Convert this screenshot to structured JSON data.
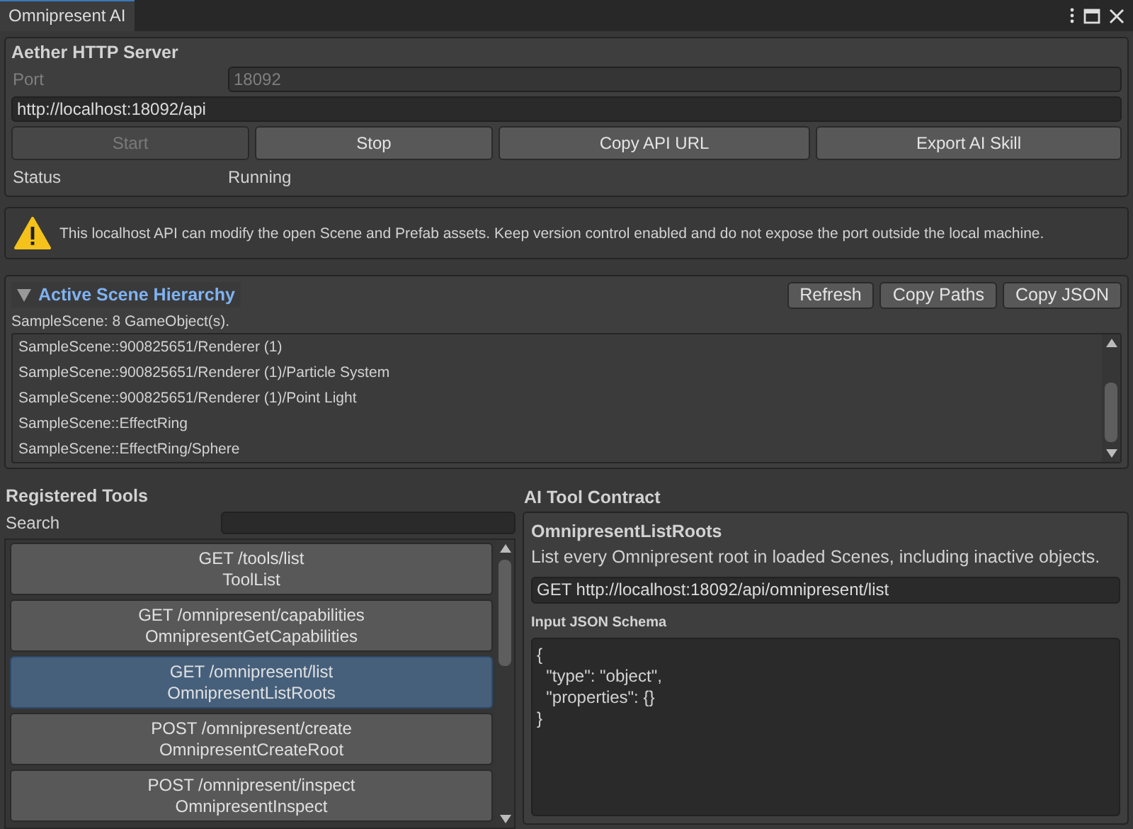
{
  "window": {
    "tab": "Omnipresent AI"
  },
  "server": {
    "title": "Aether HTTP Server",
    "port_label": "Port",
    "port": "18092",
    "url": "http://localhost:18092/api",
    "buttons": [
      {
        "label": "Start",
        "disabled": true
      },
      {
        "label": "Stop",
        "disabled": false
      },
      {
        "label": "Copy API URL",
        "disabled": false
      },
      {
        "label": "Export AI Skill",
        "disabled": false
      }
    ],
    "status_label": "Status",
    "status": "Running"
  },
  "warning": "This localhost API can modify the open Scene and Prefab assets. Keep version control enabled and do not expose the port outside the local machine.",
  "hierarchy": {
    "title": "Active Scene Hierarchy",
    "expanded": true,
    "buttons": [
      "Refresh",
      "Copy Paths",
      "Copy JSON"
    ],
    "summary": "SampleScene: 8 GameObject(s).",
    "items": [
      "SampleScene::900825651/Renderer (1)",
      "SampleScene::900825651/Renderer (1)/Particle System",
      "SampleScene::900825651/Renderer (1)/Point Light",
      "SampleScene::EffectRing",
      "SampleScene::EffectRing/Sphere"
    ]
  },
  "tools": {
    "title": "Registered Tools",
    "search_label": "Search",
    "items": [
      {
        "route": "GET /tools/list",
        "name": "ToolList",
        "selected": false
      },
      {
        "route": "GET /omnipresent/capabilities",
        "name": "OmnipresentGetCapabilities",
        "selected": false
      },
      {
        "route": "GET /omnipresent/list",
        "name": "OmnipresentListRoots",
        "selected": true
      },
      {
        "route": "POST /omnipresent/create",
        "name": "OmnipresentCreateRoot",
        "selected": false
      },
      {
        "route": "POST /omnipresent/inspect",
        "name": "OmnipresentInspect",
        "selected": false
      }
    ]
  },
  "contract": {
    "title": "AI Tool Contract",
    "name": "OmnipresentListRoots",
    "description": "List every Omnipresent root in loaded Scenes, including inactive objects.",
    "endpoint": "GET http://localhost:18092/api/omnipresent/list",
    "schema_label": "Input JSON Schema",
    "schema": [
      "{",
      "  \"type\": \"object\",",
      "  \"properties\": {}",
      "}"
    ]
  }
}
